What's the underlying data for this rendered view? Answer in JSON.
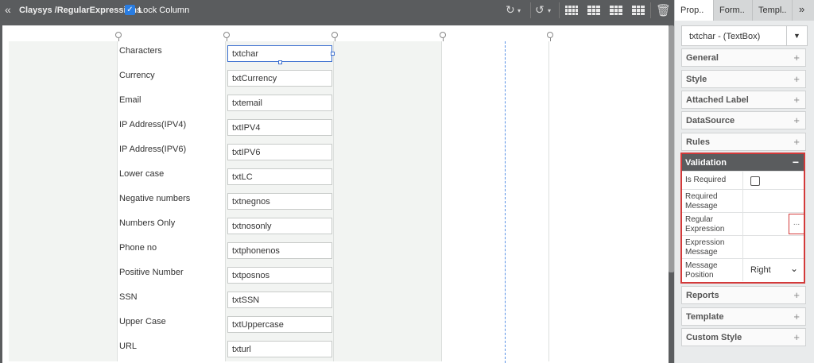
{
  "toolbar": {
    "back_icon": "«",
    "title": "Claysys /RegularExpressions",
    "lock_label": "Lock Column",
    "lock_checked": true
  },
  "form": {
    "rows": [
      {
        "label": "Characters",
        "textbox": "txtchar"
      },
      {
        "label": "Currency",
        "textbox": "txtCurrency"
      },
      {
        "label": "Email",
        "textbox": "txtemail"
      },
      {
        "label": "IP Address(IPV4)",
        "textbox": "txtIPV4"
      },
      {
        "label": "IP Address(IPV6)",
        "textbox": "txtIPV6"
      },
      {
        "label": "Lower case",
        "textbox": "txtLC"
      },
      {
        "label": "Negative numbers",
        "textbox": "txtnegnos"
      },
      {
        "label": "Numbers Only",
        "textbox": "txtnosonly"
      },
      {
        "label": "Phone no",
        "textbox": "txtphonenos"
      },
      {
        "label": "Positive Number",
        "textbox": "txtposnos"
      },
      {
        "label": "SSN",
        "textbox": "txtSSN"
      },
      {
        "label": "Upper Case",
        "textbox": "txtUppercase"
      },
      {
        "label": "URL",
        "textbox": "txturl"
      }
    ]
  },
  "panel": {
    "tabs": [
      "Prop..",
      "Form..",
      "Templ..",
      "»"
    ],
    "selected_control": "txtchar - (TextBox)",
    "sections_top": [
      "General",
      "Style",
      "Attached Label",
      "DataSource",
      "Rules"
    ],
    "validation": {
      "title": "Validation",
      "collapse": "−",
      "is_required": "Is Required",
      "required_message": "Required Message",
      "regular_expression": "Regular Expression",
      "ellipsis": "...",
      "expression_message": "Expression Message",
      "message_position": "Message Position",
      "message_position_value": "Right"
    },
    "sections_bottom": [
      "Reports",
      "Template",
      "Custom Style"
    ],
    "expand": "+"
  },
  "colors": {
    "toolbar_bg": "#5a5c5e",
    "highlight": "#d33a3a",
    "accent": "#2a7de1"
  }
}
